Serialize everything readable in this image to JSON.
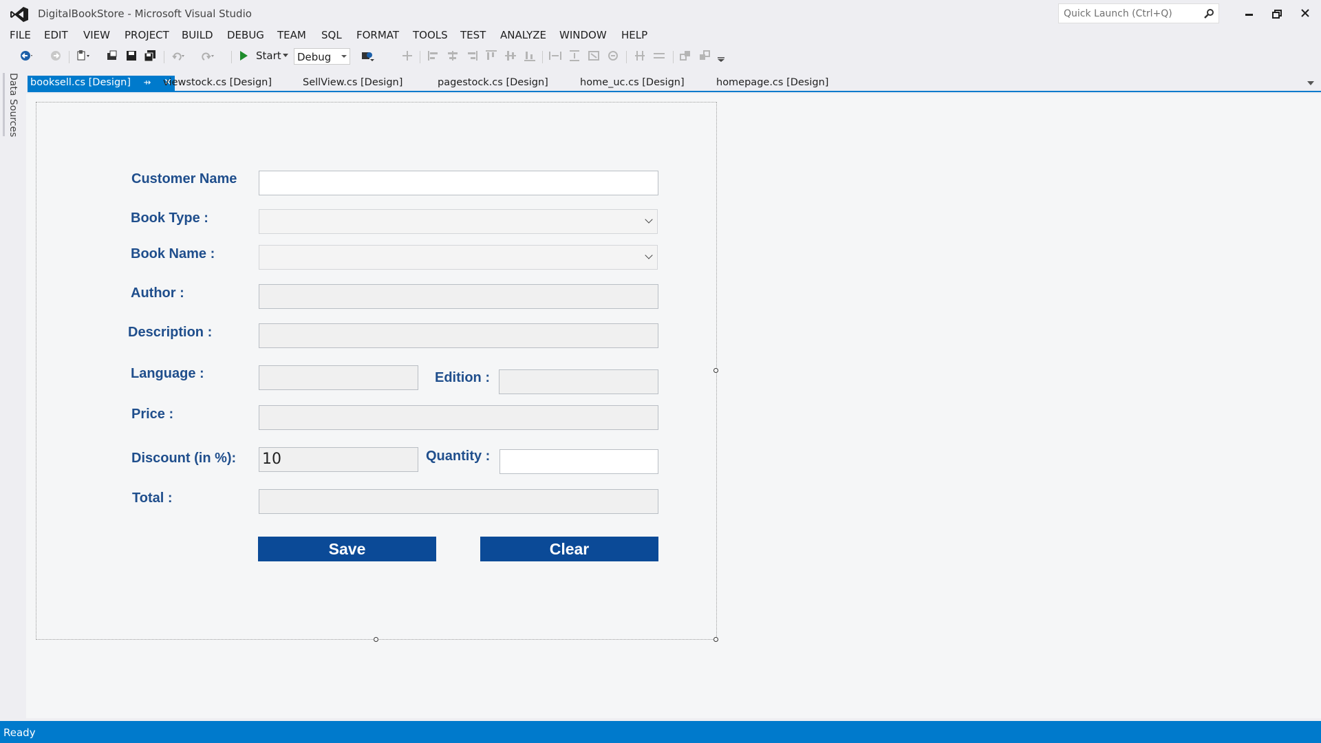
{
  "window": {
    "title": "DigitalBookStore - Microsoft Visual Studio",
    "quick_launch_placeholder": "Quick Launch (Ctrl+Q)"
  },
  "menu": [
    "FILE",
    "EDIT",
    "VIEW",
    "PROJECT",
    "BUILD",
    "DEBUG",
    "TEAM",
    "SQL",
    "FORMAT",
    "TOOLS",
    "TEST",
    "ANALYZE",
    "WINDOW",
    "HELP"
  ],
  "toolbar": {
    "start_label": "Start",
    "config_value": "Debug"
  },
  "left_panel": {
    "data_sources_label": "Data Sources"
  },
  "tabs": [
    {
      "label": "booksell.cs [Design]",
      "active": true
    },
    {
      "label": "viewstock.cs [Design]",
      "active": false
    },
    {
      "label": "SellView.cs [Design]",
      "active": false
    },
    {
      "label": "pagestock.cs [Design]",
      "active": false
    },
    {
      "label": "home_uc.cs [Design]",
      "active": false
    },
    {
      "label": "homepage.cs [Design]",
      "active": false
    }
  ],
  "form": {
    "customer_name_label": "Customer Name",
    "book_type_label": "Book Type :",
    "book_name_label": "Book Name :",
    "author_label": "Author :",
    "description_label": "Description :",
    "language_label": "Language :",
    "edition_label": "Edition :",
    "price_label": "Price :",
    "discount_label": "Discount (in %):",
    "discount_value": "10",
    "quantity_label": "Quantity :",
    "total_label": "Total :",
    "save_label": "Save",
    "clear_label": "Clear"
  },
  "status": {
    "text": "Ready"
  },
  "colors": {
    "accent": "#007acc",
    "label_color": "#1f4e8c",
    "button_color": "#0b4a97"
  }
}
